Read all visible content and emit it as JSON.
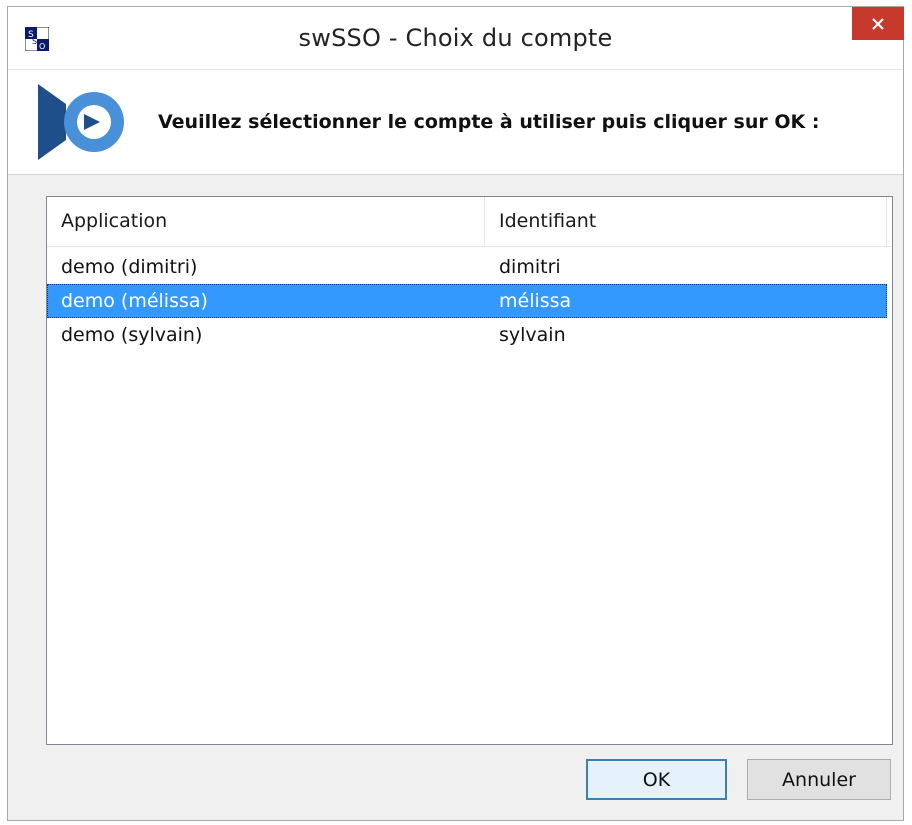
{
  "window": {
    "title": "swSSO - Choix du compte",
    "app_icon": "swsso-app-icon",
    "close_icon": "close-icon",
    "close_color": "#c7392d"
  },
  "header": {
    "logo": "swsso-logo-icon",
    "message": "Veuillez sélectionner le compte à utiliser puis cliquer sur OK :"
  },
  "list": {
    "columns": [
      "Application",
      "Identifiant"
    ],
    "rows": [
      {
        "application": "demo (dimitri)",
        "identifiant": "dimitri",
        "selected": false
      },
      {
        "application": "demo (mélissa)",
        "identifiant": "mélissa",
        "selected": true
      },
      {
        "application": "demo (sylvain)",
        "identifiant": "sylvain",
        "selected": false
      }
    ],
    "selection_color": "#3399ff"
  },
  "buttons": {
    "ok": "OK",
    "cancel": "Annuler"
  }
}
